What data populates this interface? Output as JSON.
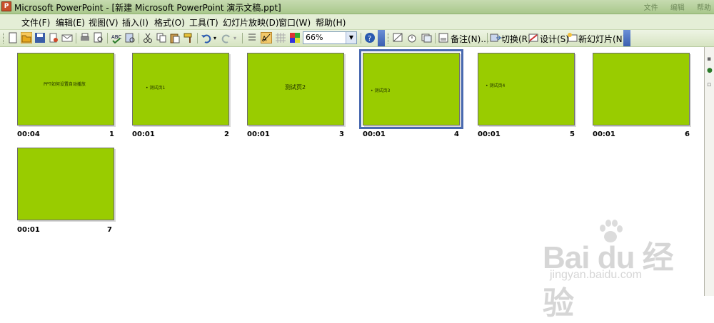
{
  "window": {
    "title": "Microsoft PowerPoint - [新建 Microsoft PowerPoint 演示文稿.ppt]",
    "controls": [
      "文件",
      "编辑",
      "帮助"
    ]
  },
  "menu": [
    {
      "label": "文件(F)"
    },
    {
      "label": "编辑(E)"
    },
    {
      "label": "视图(V)"
    },
    {
      "label": "插入(I)"
    },
    {
      "label": "格式(O)"
    },
    {
      "label": "工具(T)"
    },
    {
      "label": "幻灯片放映(D)"
    },
    {
      "label": "窗口(W)"
    },
    {
      "label": "帮助(H)"
    }
  ],
  "toolbar": {
    "zoom": "66%",
    "notes_label": "备注(N)...",
    "transition_label": "切换(R)",
    "design_label": "设计(S)",
    "new_slide_label": "新幻灯片(N)"
  },
  "slides": [
    {
      "number": "1",
      "time": "00:04",
      "text": "PPT如何设置自动播放",
      "style": "title"
    },
    {
      "number": "2",
      "time": "00:01",
      "text": "• 测试页1",
      "style": "bullet"
    },
    {
      "number": "3",
      "time": "00:01",
      "text": "测试页2",
      "style": "center"
    },
    {
      "number": "4",
      "time": "00:01",
      "text": "• 测试页3",
      "style": "bullet",
      "selected": true
    },
    {
      "number": "5",
      "time": "00:01",
      "text": "• 测试页4",
      "style": "bullet"
    },
    {
      "number": "6",
      "time": "00:01",
      "text": "",
      "style": "blank"
    },
    {
      "number": "7",
      "time": "00:01",
      "text": "",
      "style": "blank"
    }
  ],
  "watermark": {
    "logo": "Bai du 经验",
    "url": "jingyan.baidu.com"
  },
  "colors": {
    "slide_bg": "#99cc00",
    "selection": "#4a6ab0"
  }
}
